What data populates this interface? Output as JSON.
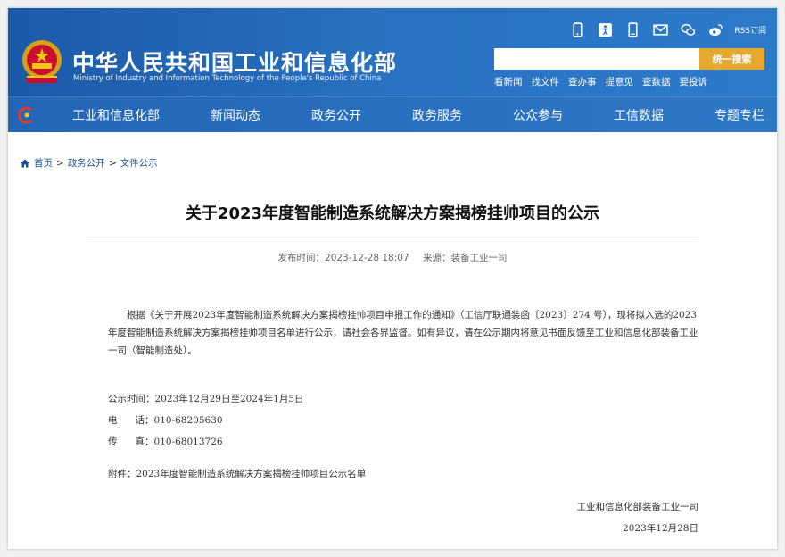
{
  "header": {
    "site_title": "中华人民共和国工业和信息化部",
    "site_subtitle": "Ministry of Industry and Information Technology of the People's Republic of China",
    "icons": [
      "mobile-icon",
      "accessibility-icon",
      "phone-icon",
      "mail-icon",
      "wechat-icon",
      "weibo-icon",
      "rss-icon"
    ],
    "rss_label": "RSS订阅",
    "search_placeholder": "",
    "search_button": "统一搜索",
    "quick_links": [
      "看新闻",
      "找文件",
      "查办事",
      "提意见",
      "查数据",
      "要投诉"
    ]
  },
  "nav": {
    "items": [
      "工业和信息化部",
      "新闻动态",
      "政务公开",
      "政务服务",
      "公众参与",
      "工信数据",
      "专题专栏"
    ]
  },
  "breadcrumb": {
    "home": "首页",
    "sep1": ">",
    "level1": "政务公开",
    "sep2": ">",
    "level2": "文件公示"
  },
  "article": {
    "title": "关于2023年度智能制造系统解决方案揭榜挂帅项目的公示",
    "publish_time": "发布时间：2023-12-28 18:07",
    "source": "来源：装备工业一司",
    "body": "根据《关于开展2023年度智能制造系统解决方案揭榜挂帅项目申报工作的通知》（工信厅联通装函〔2023〕274 号），现将拟入选的2023年度智能制造系统解决方案揭榜挂帅项目名单进行公示，请社会各界监督。如有异议，请在公示期内将意见书面反馈至工业和信息化部装备工业一司（智能制造处）。",
    "period": "公示时间：2023年12月29日至2024年1月5日",
    "phone": "电      话：010-68205630",
    "fax": "传      真：010-68013726",
    "attachment": "附件：2023年度智能制造系统解决方案揭榜挂帅项目公示名单",
    "signature_org": "工业和信息化部装备工业一司",
    "signature_date": "2023年12月28日"
  },
  "colors": {
    "header_blue": "#1b5aa8",
    "search_button": "#e4a92e",
    "link_blue": "#1a4d94"
  }
}
